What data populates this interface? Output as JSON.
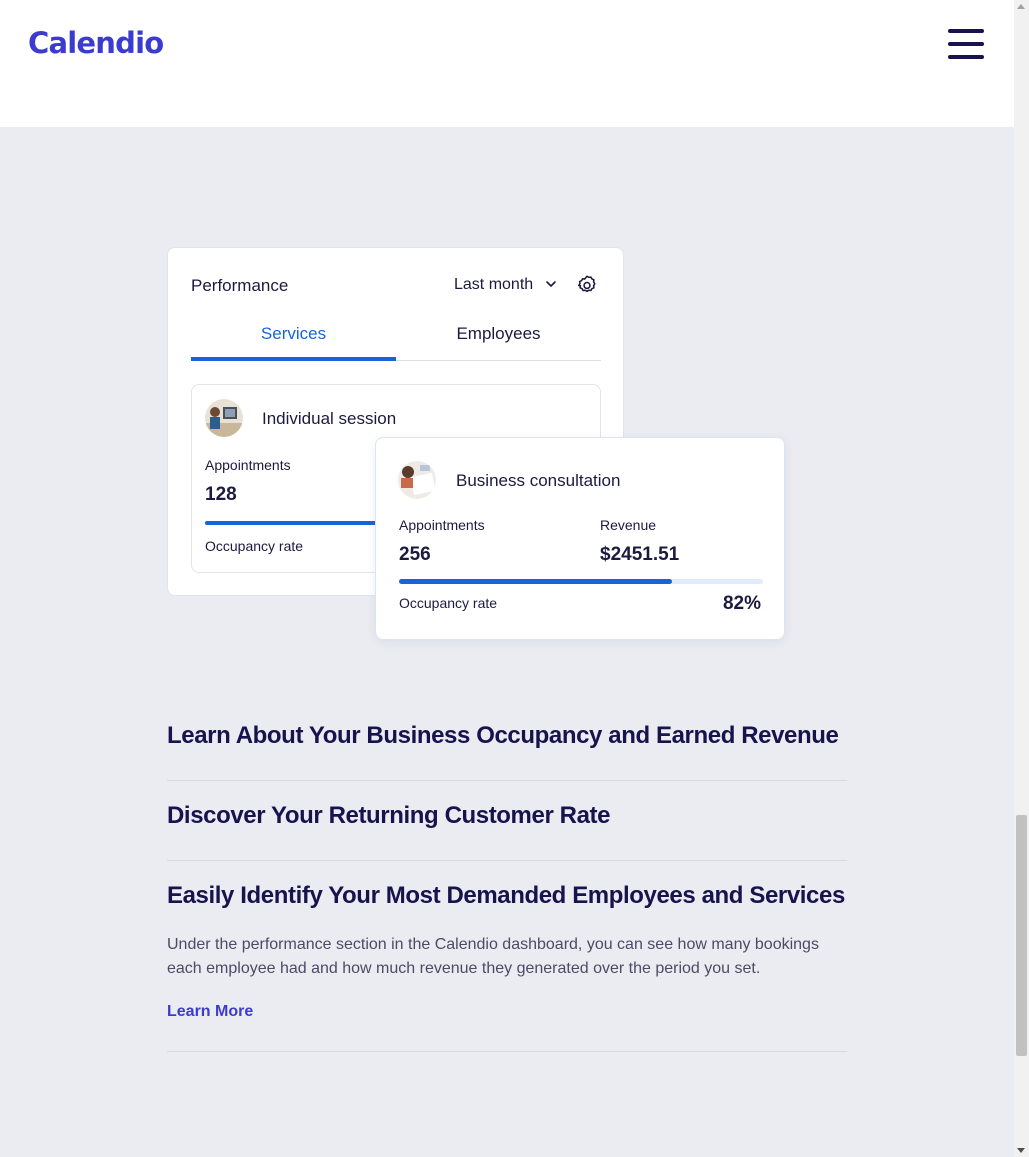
{
  "header": {
    "logo": "Calendio",
    "menu_icon": "hamburger-menu-icon"
  },
  "performance_card": {
    "title": "Performance",
    "period": "Last month",
    "tabs": [
      {
        "label": "Services",
        "active": true
      },
      {
        "label": "Employees",
        "active": false
      }
    ],
    "service_card": {
      "name": "Individual session",
      "appointments_label": "Appointments",
      "appointments_value": "128",
      "occupancy_label": "Occupancy rate",
      "occupancy_fraction": 0.75
    }
  },
  "floating_card": {
    "name": "Business consultation",
    "appointments_label": "Appointments",
    "appointments_value": "256",
    "revenue_label": "Revenue",
    "revenue_value": "$2451.51",
    "occupancy_label": "Occupancy rate",
    "occupancy_value": "82%",
    "occupancy_fraction": 0.75
  },
  "accordion": {
    "items": [
      {
        "heading": "Learn About Your Business Occupancy and Earned Revenue"
      },
      {
        "heading": "Discover Your Returning Customer Rate"
      },
      {
        "heading": "Easily Identify Your Most Demanded Employees and Services",
        "description": "Under the performance section in the Calendio dashboard, you can see how many bookings each employee had and how much revenue they generated over the period you set.",
        "link": "Learn More"
      }
    ]
  },
  "colors": {
    "brand": "#3b3ccf",
    "accent_blue": "#1764d8",
    "heading": "#16134d",
    "background": "#ebecf1"
  }
}
